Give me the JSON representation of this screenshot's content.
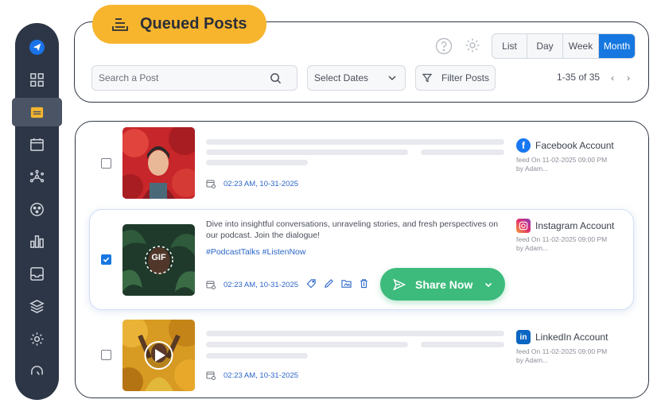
{
  "header": {
    "title": "Queued Posts",
    "views": [
      "List",
      "Day",
      "Week",
      "Month"
    ],
    "active_view": "Month",
    "search_placeholder": "Search a Post",
    "dates_label": "Select Dates",
    "filter_label": "Filter Posts",
    "pagination": "1-35 of 35"
  },
  "posts": [
    {
      "date": "02:23 AM, 10-31-2025",
      "account": "Facebook Account",
      "meta_line1": "feed On 11-02-2025 09:00 PM",
      "meta_line2": "by Adam...",
      "checked": false
    },
    {
      "caption": "Dive into insightful conversations, unraveling stories, and fresh perspectives on our podcast. Join the dialogue!",
      "hashtags": "#PodcastTalks #ListenNow",
      "date": "02:23 AM, 10-31-2025",
      "account": "Instagram  Account",
      "meta_line1": "feed On 11-02-2025 09:00 PM",
      "meta_line2": "by Adam...",
      "gif_badge": "GIF",
      "share_label": "Share Now",
      "checked": true
    },
    {
      "date": "02:23 AM, 10-31-2025",
      "account": "LinkedIn Account",
      "meta_line1": "feed On 11-02-2025 09:00 PM",
      "meta_line2": "by Adam...",
      "checked": false
    }
  ],
  "colors": {
    "sidebar": "#2d3646",
    "accent_yellow": "#f7b52e",
    "primary_blue": "#1677e0",
    "share_green": "#3dbb7c",
    "facebook": "#1877f2",
    "linkedin": "#0a66c2"
  }
}
